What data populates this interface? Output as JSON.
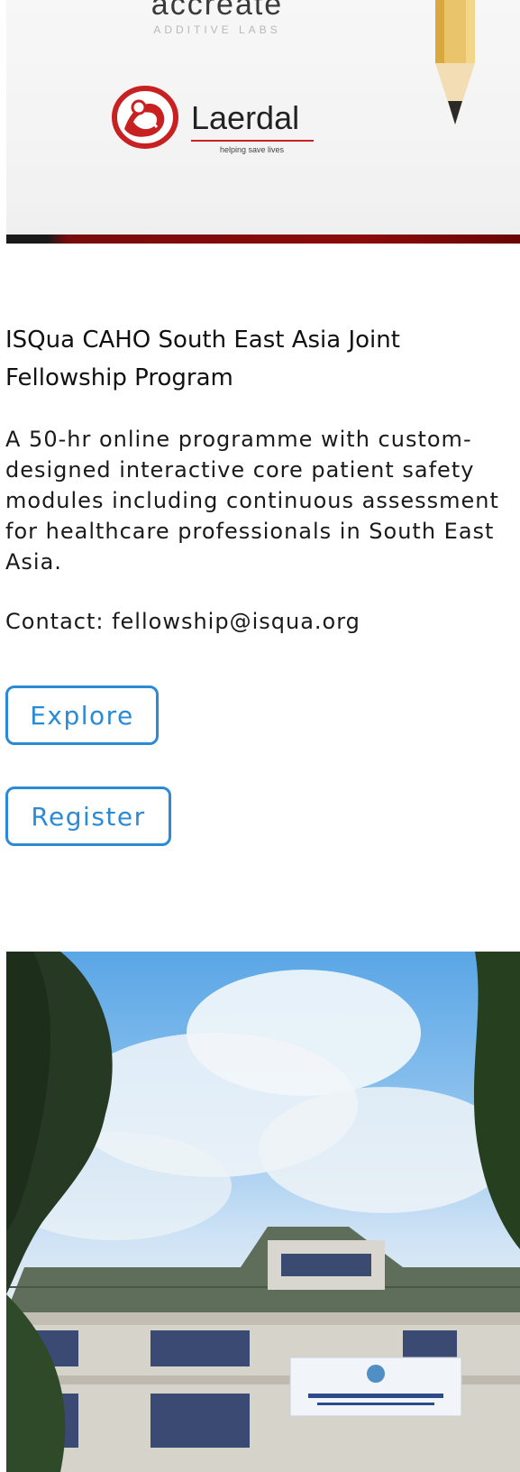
{
  "partner_banner": {
    "accreate_word": "accreate",
    "accreate_subtitle": "ADDITIVE LABS",
    "laerdal_name": "Laerdal",
    "laerdal_tagline": "helping save lives"
  },
  "program": {
    "title": "ISQua CAHO South East Asia Joint Fellowship Program",
    "description": "A 50-hr online programme with custom-designed interactive core patient safety modules including continuous assessment for healthcare professionals in South East Asia.",
    "contact": "Contact: fellowship@isqua.org",
    "explore_label": "Explore",
    "register_label": "Register"
  },
  "colors": {
    "accent": "#2b8ad6",
    "banner_bar": "#8b0a0a",
    "text": "#111111"
  }
}
